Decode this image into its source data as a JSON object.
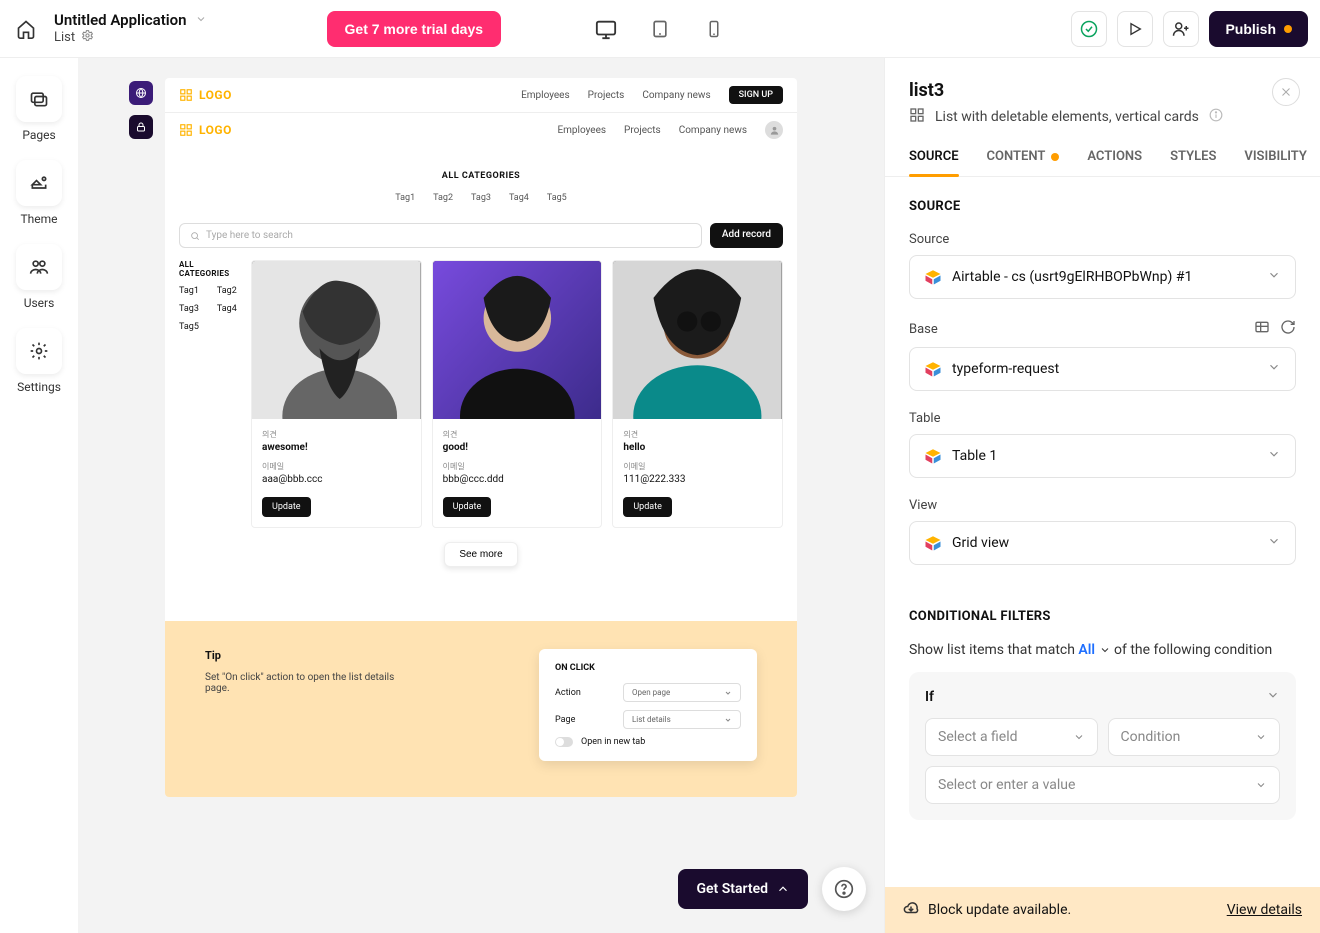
{
  "header": {
    "app_title": "Untitled Application",
    "page_name": "List",
    "trial_button": "Get 7 more trial days",
    "publish": "Publish"
  },
  "leftnav": {
    "pages": "Pages",
    "theme": "Theme",
    "users": "Users",
    "settings": "Settings"
  },
  "preview": {
    "logo": "LOGO",
    "nav": {
      "employees": "Employees",
      "projects": "Projects",
      "company_news": "Company news",
      "signup": "SIGN UP"
    },
    "all_categories": "ALL CATEGORIES",
    "tags": {
      "t1": "Tag1",
      "t2": "Tag2",
      "t3": "Tag3",
      "t4": "Tag4",
      "t5": "Tag5"
    },
    "search_ph": "Type here to search",
    "add_record": "Add record",
    "side_all": "ALL CATEGORIES",
    "card_label_opinion": "의견",
    "card_label_email": "이메일",
    "cards": [
      {
        "opinion": "awesome!",
        "email": "aaa@bbb.ccc"
      },
      {
        "opinion": "good!",
        "email": "bbb@ccc.ddd"
      },
      {
        "opinion": "hello",
        "email": "111@222.333"
      }
    ],
    "update": "Update",
    "see_more": "See more",
    "tip_title": "Tip",
    "tip_text": "Set \"On click\" action to open the list details page.",
    "tip_panel": {
      "on_click": "ON CLICK",
      "action": "Action",
      "action_val": "Open page",
      "page": "Page",
      "page_val": "List details",
      "open_tab": "Open in new tab"
    }
  },
  "inspector": {
    "title": "list3",
    "subtitle": "List with deletable elements, vertical cards",
    "tabs": {
      "source": "SOURCE",
      "content": "CONTENT",
      "actions": "ACTIONS",
      "styles": "STYLES",
      "visibility": "VISIBILITY"
    },
    "source_h": "SOURCE",
    "source_label": "Source",
    "source_val": "Airtable - cs (usrt9gElRHBOPbWnp) #1",
    "base_label": "Base",
    "base_val": "typeform-request",
    "table_label": "Table",
    "table_val": "Table 1",
    "view_label": "View",
    "view_val": "Grid view",
    "filters_h": "CONDITIONAL FILTERS",
    "filter_pre": "Show list items that match ",
    "filter_all": "All",
    "filter_post": " of the following condition",
    "if": "If",
    "select_field": "Select a field",
    "condition": "Condition",
    "value_ph": "Select or enter a value",
    "block_update": "Block update available.",
    "view_details": "View details"
  },
  "floating": {
    "get_started": "Get Started"
  }
}
